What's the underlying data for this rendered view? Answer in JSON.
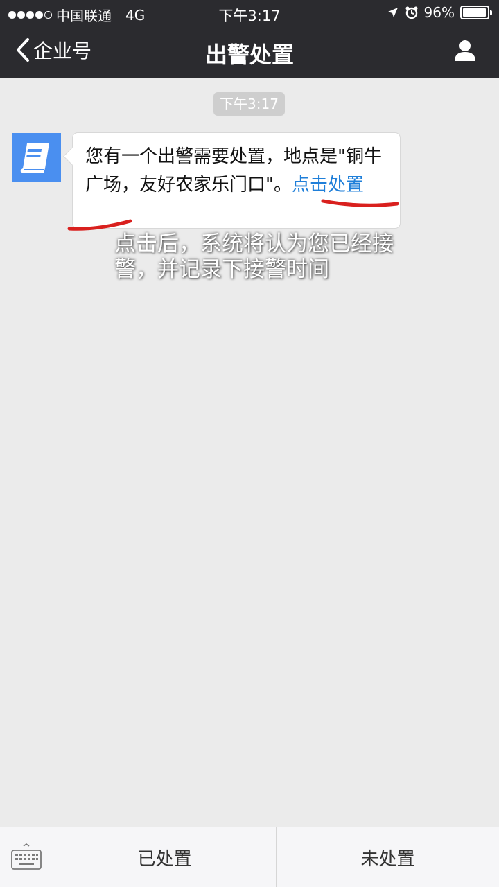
{
  "status_bar": {
    "carrier": "中国联通",
    "network": "4G",
    "time": "下午3:17",
    "battery": "96%",
    "battery_level": 0.96,
    "signal_bars": 4,
    "icons": [
      "location-arrow-icon",
      "alarm-icon",
      "battery-icon"
    ]
  },
  "nav": {
    "back_label": "企业号",
    "title": "出警处置",
    "icons": [
      "chevron-left-icon",
      "profile-icon"
    ]
  },
  "chat": {
    "timestamp": "下午3:17",
    "avatar_icon": "book-icon",
    "message_text": "您有一个出警需要处置，地点是\"铜牛广场，友好农家乐门口\"。",
    "message_link": "点击处置"
  },
  "annotation": {
    "text": "点击后，系统将认为您已经接警，并记录下接警时间",
    "underline_color": "#d9201e"
  },
  "bottom_menu": {
    "keyboard_icon": "keyboard-icon",
    "buttons": [
      "已处置",
      "未处置"
    ]
  },
  "colors": {
    "header_bg": "#2b2b2f",
    "link": "#1f7fd9",
    "avatar_bg": "#4a8ff0",
    "chat_bg": "#ebebeb"
  }
}
